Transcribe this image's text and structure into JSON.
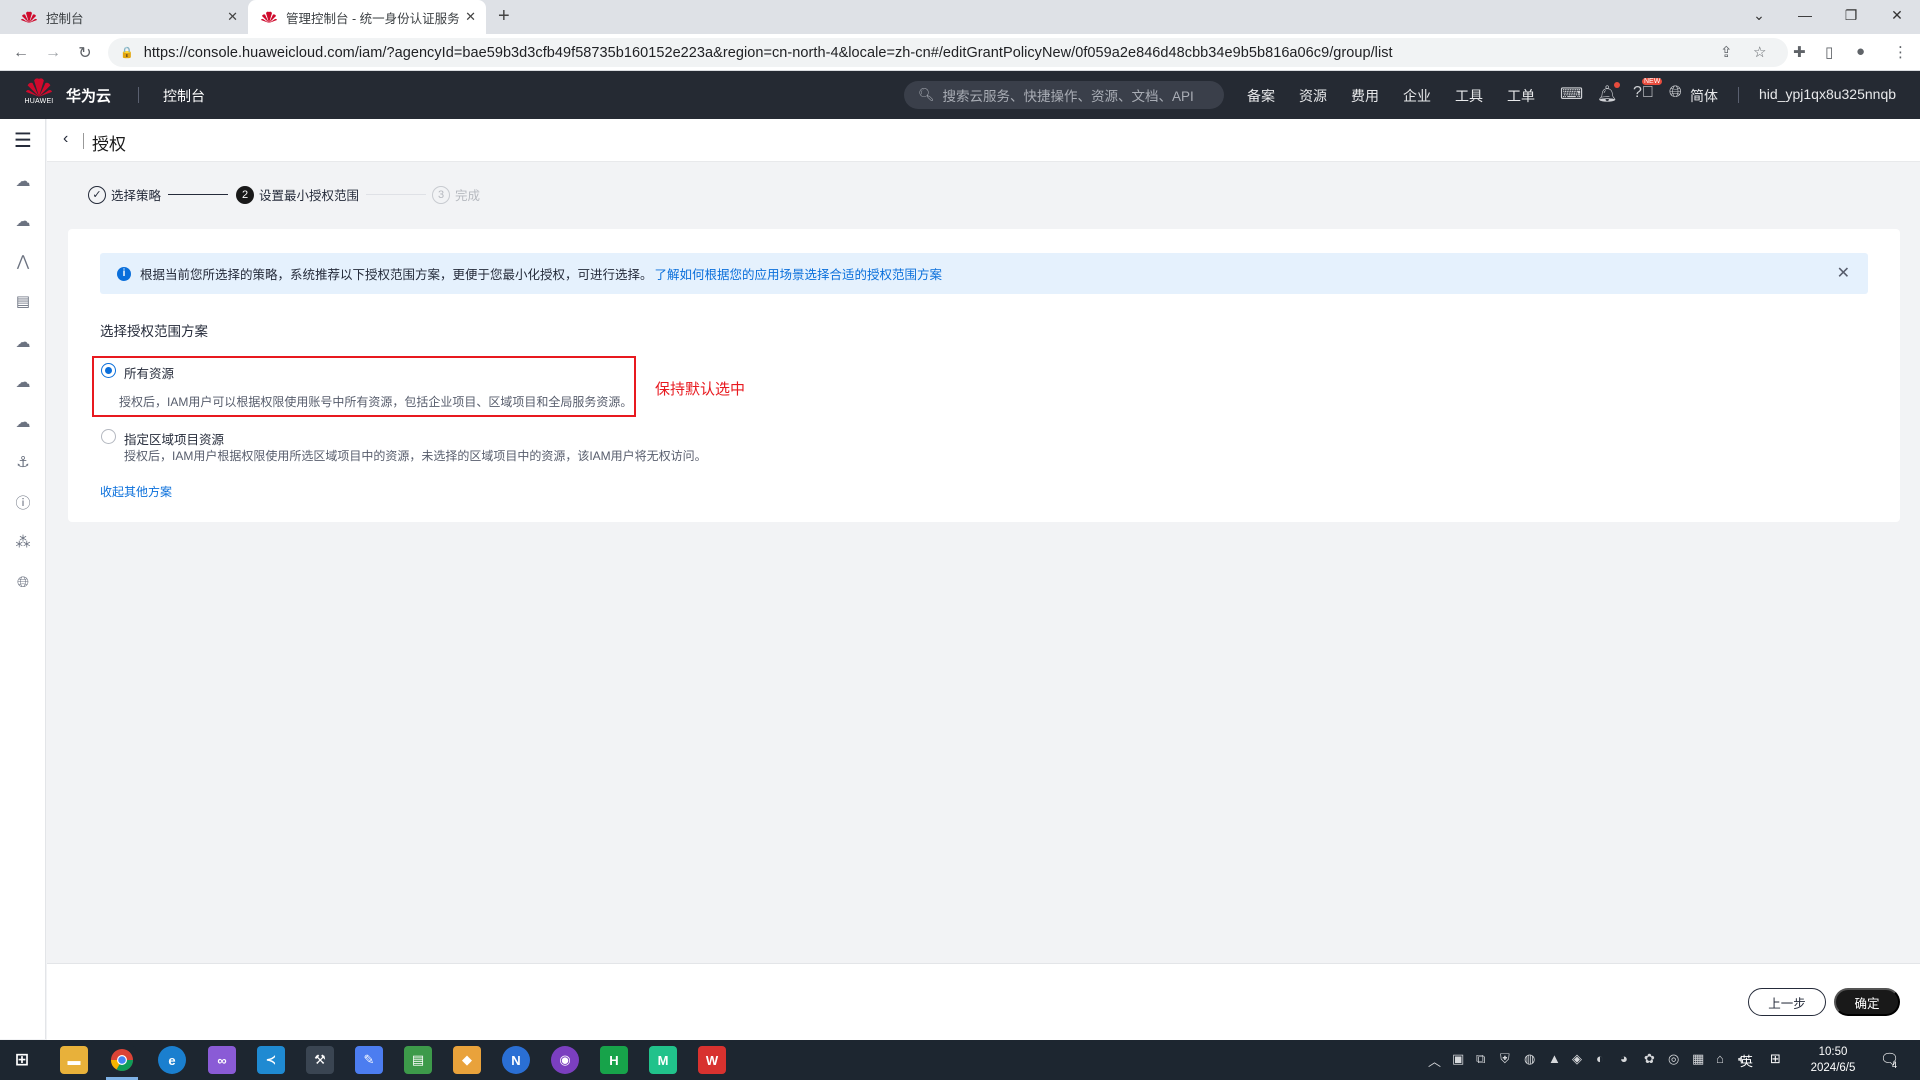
{
  "browser": {
    "tabs": [
      {
        "title": "控制台"
      },
      {
        "title": "管理控制台 - 统一身份认证服务"
      }
    ],
    "new_tab": "+",
    "url": "https://console.huaweicloud.com/iam/?agencyId=bae59b3d3cfb49f58735b160152e223a&region=cn-north-4&locale=zh-cn#/editGrantPolicyNew/0f059a2e846d48cbb34e9b5b816a06c9/group/list"
  },
  "header": {
    "logo_text": "HUAWEI",
    "brand": "华为云",
    "console": "控制台",
    "search_placeholder": "搜索云服务、快捷操作、资源、文档、API",
    "nav": [
      "备案",
      "资源",
      "费用",
      "企业",
      "工具",
      "工单"
    ],
    "new_badge": "NEW",
    "language": "简体",
    "username": "hid_ypj1qx8u325nnqb"
  },
  "page": {
    "title": "授权",
    "steps": [
      {
        "label": "选择策略",
        "status": "done"
      },
      {
        "num": "2",
        "label": "设置最小授权范围",
        "status": "current"
      },
      {
        "num": "3",
        "label": "完成",
        "status": "pending"
      }
    ],
    "info": {
      "text": "根据当前您所选择的策略，系统推荐以下授权范围方案，更便于您最小化授权，可进行选择。",
      "link": "了解如何根据您的应用场景选择合适的授权范围方案"
    },
    "section_title": "选择授权范围方案",
    "options": [
      {
        "label": "所有资源",
        "desc": "授权后，IAM用户可以根据权限使用账号中所有资源，包括企业项目、区域项目和全局服务资源。",
        "selected": true
      },
      {
        "label": "指定区域项目资源",
        "desc": "授权后，IAM用户根据权限使用所选区域项目中的资源，未选择的区域项目中的资源，该IAM用户将无权访问。",
        "selected": false
      }
    ],
    "annotation": "保持默认选中",
    "collapse_link": "收起其他方案",
    "buttons": {
      "prev": "上一步",
      "ok": "确定"
    }
  },
  "taskbar": {
    "ime": "英",
    "time": "10:50",
    "date": "2024/6/5",
    "notify_count": "4"
  },
  "colors": {
    "accent": "#0a6fdb",
    "annotation_red": "#e8191f",
    "header_bg": "#252a33",
    "huawei_red": "#cf0a2c"
  }
}
